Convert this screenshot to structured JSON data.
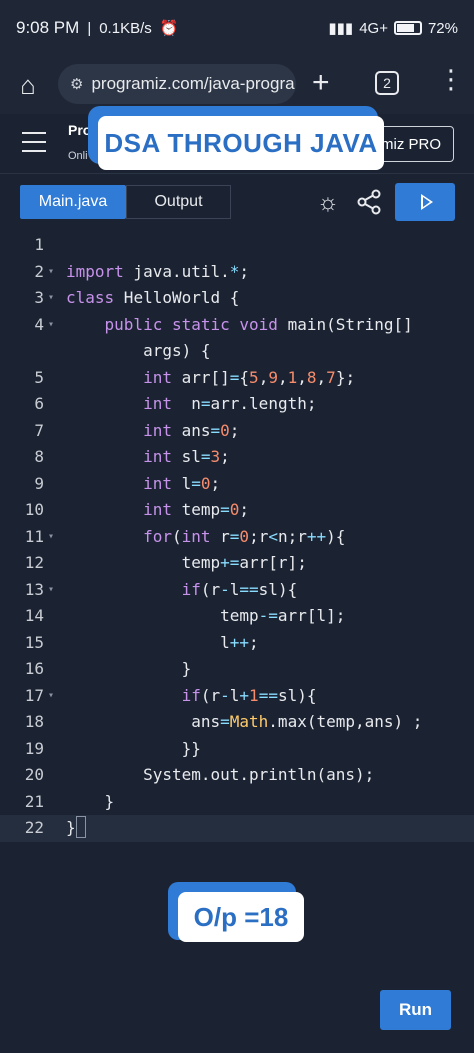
{
  "status_bar": {
    "time": "9:08 PM",
    "speed": "0.1KB/s",
    "network": "4G+",
    "battery": "72%"
  },
  "browser": {
    "url": "programiz.com/java-progra",
    "tab_count": "2"
  },
  "site": {
    "logo": "Pro",
    "logo_sub": "Onli",
    "pro_label": "miz PRO"
  },
  "banner": {
    "title": "DSA THROUGH JAVA"
  },
  "toolbar": {
    "tab_main": "Main.java",
    "tab_output": "Output"
  },
  "editor": {
    "lines": [
      {
        "n": "1",
        "fold": false,
        "code": ""
      },
      {
        "n": "2",
        "fold": true,
        "code": "import java.util.*;"
      },
      {
        "n": "3",
        "fold": true,
        "code": "class HelloWorld {"
      },
      {
        "n": "4",
        "fold": true,
        "code": "    public static void main(String[]"
      },
      {
        "n": "",
        "fold": false,
        "code": "        args) {"
      },
      {
        "n": "5",
        "fold": false,
        "code": "        int arr[]={5,9,1,8,7};"
      },
      {
        "n": "6",
        "fold": false,
        "code": "        int  n=arr.length;"
      },
      {
        "n": "7",
        "fold": false,
        "code": "        int ans=0;"
      },
      {
        "n": "8",
        "fold": false,
        "code": "        int sl=3;"
      },
      {
        "n": "9",
        "fold": false,
        "code": "        int l=0;"
      },
      {
        "n": "10",
        "fold": false,
        "code": "        int temp=0;"
      },
      {
        "n": "11",
        "fold": true,
        "code": "        for(int r=0;r<n;r++){"
      },
      {
        "n": "12",
        "fold": false,
        "code": "            temp+=arr[r];"
      },
      {
        "n": "13",
        "fold": true,
        "code": "            if(r-l==sl){"
      },
      {
        "n": "14",
        "fold": false,
        "code": "                temp-=arr[l];"
      },
      {
        "n": "15",
        "fold": false,
        "code": "                l++;"
      },
      {
        "n": "16",
        "fold": false,
        "code": "            }"
      },
      {
        "n": "17",
        "fold": true,
        "code": "            if(r-l+1==sl){"
      },
      {
        "n": "18",
        "fold": false,
        "code": "             ans=Math.max(temp,ans) ;"
      },
      {
        "n": "19",
        "fold": false,
        "code": "            }}"
      },
      {
        "n": "20",
        "fold": false,
        "code": "        System.out.println(ans);"
      },
      {
        "n": "21",
        "fold": false,
        "code": "    }"
      },
      {
        "n": "22",
        "fold": false,
        "code": "}"
      }
    ]
  },
  "output_overlay": {
    "text": "O/p =18"
  },
  "run_button": {
    "label": "Run"
  }
}
